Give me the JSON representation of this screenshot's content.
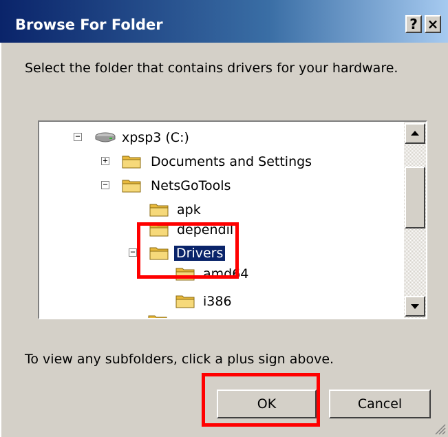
{
  "window": {
    "title": "Browse For Folder",
    "help_label": "?",
    "close_label": "×"
  },
  "instruction": "Select the folder that contains drivers for your hardware.",
  "tree": {
    "nodes": [
      {
        "label": "xpsp3 (C:)",
        "expander": "−",
        "icon": "drive-icon"
      },
      {
        "label": "Documents and Settings",
        "expander": "+",
        "icon": "folder-icon"
      },
      {
        "label": "NetsGoTools",
        "expander": "−",
        "icon": "folder-icon"
      },
      {
        "label": "apk",
        "expander": "",
        "icon": "folder-icon"
      },
      {
        "label": "dependil",
        "expander": "",
        "icon": "folder-icon"
      },
      {
        "label": "Drivers",
        "expander": "−",
        "icon": "folder-icon",
        "selected": true
      },
      {
        "label": "amd64",
        "expander": "",
        "icon": "folder-icon"
      },
      {
        "label": "i386",
        "expander": "",
        "icon": "folder-icon"
      }
    ]
  },
  "footer_text": "To view any subfolders, click a plus sign above.",
  "buttons": {
    "ok": "OK",
    "cancel": "Cancel"
  },
  "colors": {
    "title_bar": "#0a246a",
    "selection": "#0a246a",
    "dialog_face": "#d4d0c8",
    "annotation": "#ff0000",
    "folder": "#f3d26b"
  }
}
